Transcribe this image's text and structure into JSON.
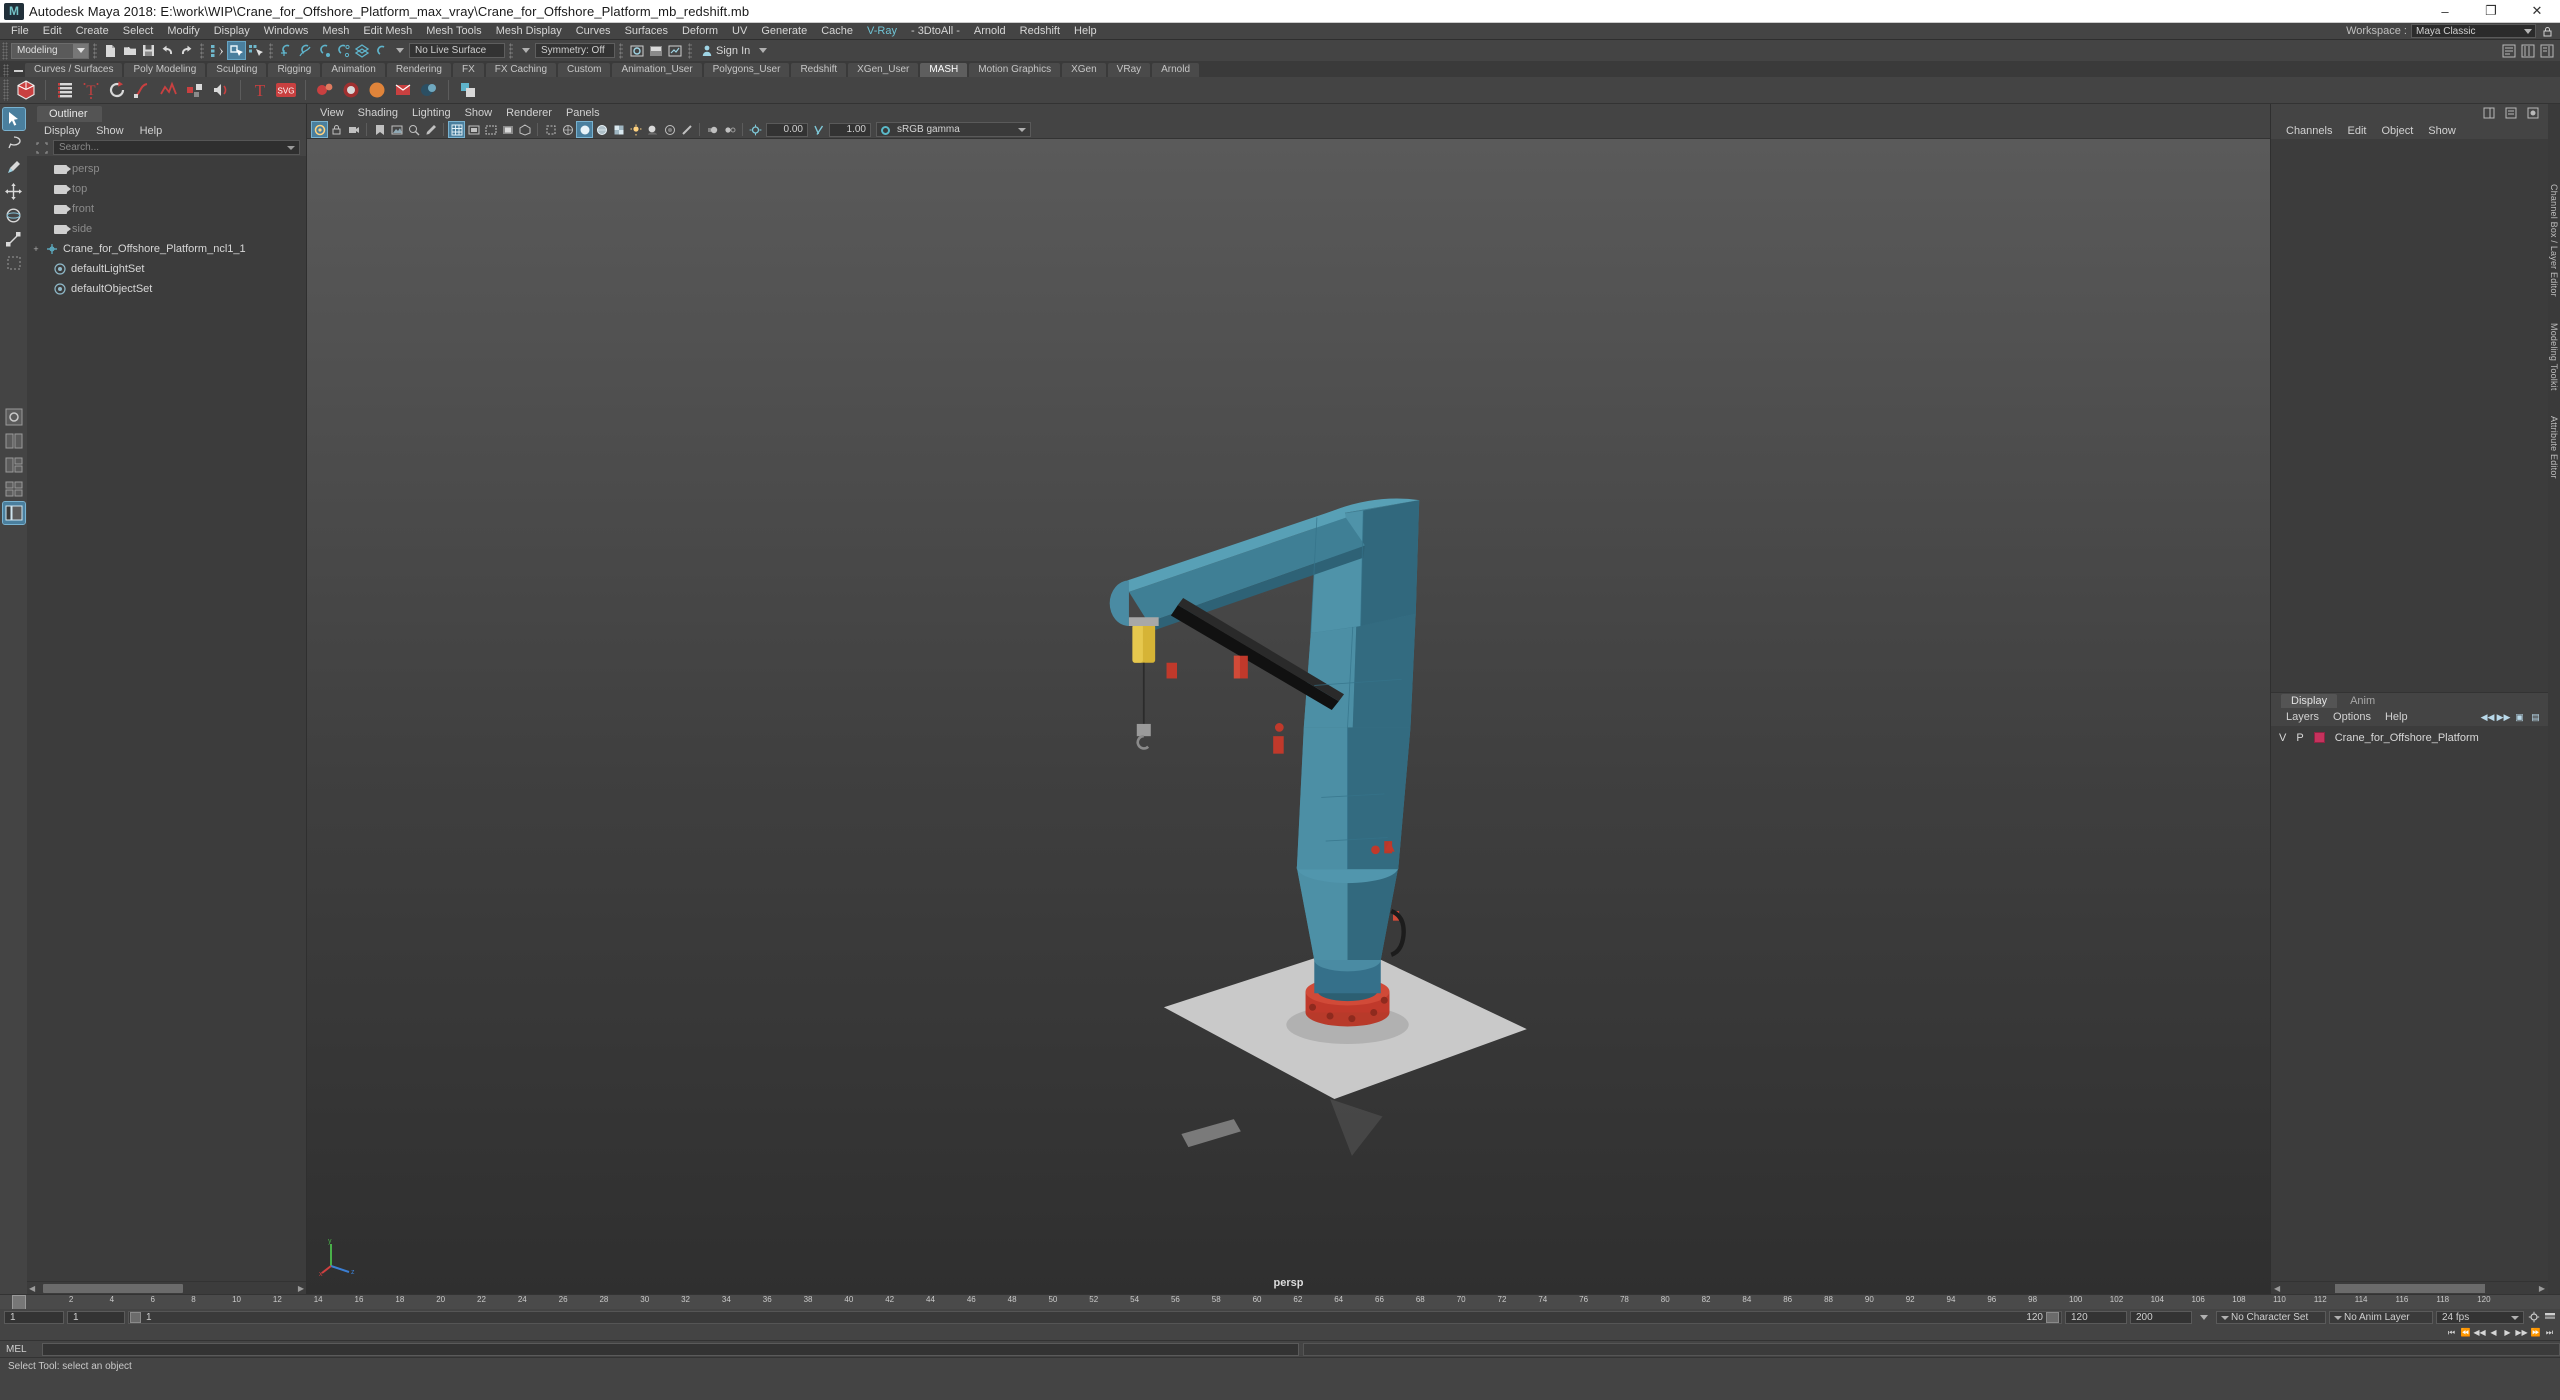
{
  "titlebar": {
    "app_icon": "maya-logo-icon",
    "title": "Autodesk Maya 2018: E:\\work\\WIP\\Crane_for_Offshore_Platform_max_vray\\Crane_for_Offshore_Platform_mb_redshift.mb",
    "minimize": "–",
    "maximize": "❐",
    "close": "✕"
  },
  "menubar": {
    "items": [
      {
        "label": "File"
      },
      {
        "label": "Edit"
      },
      {
        "label": "Create"
      },
      {
        "label": "Select"
      },
      {
        "label": "Modify"
      },
      {
        "label": "Display"
      },
      {
        "label": "Windows"
      },
      {
        "label": "Mesh"
      },
      {
        "label": "Edit Mesh"
      },
      {
        "label": "Mesh Tools"
      },
      {
        "label": "Mesh Display"
      },
      {
        "label": "Curves"
      },
      {
        "label": "Surfaces"
      },
      {
        "label": "Deform"
      },
      {
        "label": "UV"
      },
      {
        "label": "Generate"
      },
      {
        "label": "Cache"
      },
      {
        "label": "V-Ray",
        "accent": true
      },
      {
        "label": "- 3DtoAll -"
      },
      {
        "label": "Arnold"
      },
      {
        "label": "Redshift"
      },
      {
        "label": "Help"
      }
    ],
    "workspace_label": "Workspace :",
    "workspace_value": "Maya Classic"
  },
  "statusline": {
    "menu_set": "Modeling",
    "no_live_surface": "No Live Surface",
    "symmetry": "Symmetry: Off",
    "signin": "Sign In",
    "icons": [
      "new-scene-icon",
      "open-scene-icon",
      "save-scene-icon",
      "undo-icon",
      "redo-icon",
      "select-by-hierarchy-icon",
      "select-by-object-icon",
      "select-by-component-icon",
      "snap-to-grid-icon",
      "snap-to-curve-icon",
      "snap-to-point-icon",
      "snap-to-projected-center-icon",
      "snap-to-view-plane-icon",
      "snap-to-normal-icon"
    ]
  },
  "shelf": {
    "tabs": [
      {
        "label": "Curves / Surfaces"
      },
      {
        "label": "Poly Modeling"
      },
      {
        "label": "Sculpting"
      },
      {
        "label": "Rigging"
      },
      {
        "label": "Animation"
      },
      {
        "label": "Rendering"
      },
      {
        "label": "FX"
      },
      {
        "label": "FX Caching"
      },
      {
        "label": "Custom"
      },
      {
        "label": "Animation_User"
      },
      {
        "label": "Polygons_User"
      },
      {
        "label": "Redshift"
      },
      {
        "label": "XGen_User"
      },
      {
        "label": "MASH",
        "active": true
      },
      {
        "label": "Motion Graphics"
      },
      {
        "label": "XGen"
      },
      {
        "label": "VRay"
      },
      {
        "label": "Arnold"
      }
    ],
    "icon_names": [
      "mash-network-icon",
      "mash-distribute-icon",
      "mash-text-icon",
      "mash-trails-icon",
      "mash-curve-icon",
      "mash-signal-icon",
      "mash-random-icon",
      "mash-audio-icon",
      "mash-type-icon",
      "mash-svg-icon",
      "mash-dynamics-icon",
      "mash-color-icon",
      "mash-orange-icon",
      "mash-red-icon",
      "mash-blue-icon",
      "mash-replicator-icon"
    ]
  },
  "toolbox": {
    "tools": [
      {
        "name": "select-tool",
        "selected": true
      },
      {
        "name": "lasso-tool"
      },
      {
        "name": "paint-select-tool"
      },
      {
        "name": "move-tool"
      },
      {
        "name": "rotate-tool"
      },
      {
        "name": "scale-tool"
      },
      {
        "name": "last-tool-used"
      },
      {
        "name": "layout-single-icon"
      },
      {
        "name": "layout-two-panes-icon"
      },
      {
        "name": "layout-three-panes-icon"
      },
      {
        "name": "layout-four-panes-icon"
      },
      {
        "name": "layout-persp-outliner-icon"
      }
    ]
  },
  "outliner": {
    "tab": "Outliner",
    "menus": [
      "Display",
      "Show",
      "Help"
    ],
    "search_placeholder": "Search...",
    "items": [
      {
        "label": "persp",
        "icon": "camera-icon",
        "dim": true
      },
      {
        "label": "top",
        "icon": "camera-icon",
        "dim": true
      },
      {
        "label": "front",
        "icon": "camera-icon",
        "dim": true
      },
      {
        "label": "side",
        "icon": "camera-icon",
        "dim": true
      },
      {
        "label": "Crane_for_Offshore_Platform_ncl1_1",
        "icon": "transform-icon",
        "expandable": true
      },
      {
        "label": "defaultLightSet",
        "icon": "set-icon"
      },
      {
        "label": "defaultObjectSet",
        "icon": "set-icon"
      }
    ]
  },
  "viewport": {
    "menus": [
      "View",
      "Shading",
      "Lighting",
      "Show",
      "Renderer",
      "Panels"
    ],
    "exposure_value": "0.00",
    "gamma_value": "1.00",
    "color_management": "sRGB gamma",
    "camera_label": "persp",
    "axis": {
      "x": "x",
      "y": "y",
      "z": "z"
    },
    "model": {
      "name": "Crane for Offshore Platform",
      "body_color": "#3f7f95",
      "body_light": "#5794a8",
      "body_dark": "#2c5f72",
      "ground_color": "#c9c9c9",
      "accent_red": "#c0392b",
      "accent_yellow": "#d6b436"
    }
  },
  "channelbox": {
    "menus": [
      "Channels",
      "Edit",
      "Object",
      "Show"
    ]
  },
  "layers": {
    "tabs": [
      {
        "label": "Display",
        "active": true
      },
      {
        "label": "Anim",
        "active": false
      }
    ],
    "menus": [
      "Layers",
      "Options",
      "Help"
    ],
    "columns": [
      "V",
      "P"
    ],
    "rows": [
      {
        "v": "V",
        "p": "P",
        "color": "#c6325d",
        "name": "Crane_for_Offshore_Platform"
      }
    ]
  },
  "vertical_tabs": [
    "Channel Box / Layer Editor",
    "Modeling Toolkit",
    "Attribute Editor"
  ],
  "timeline": {
    "ticks": [
      "2",
      "4",
      "6",
      "8",
      "10",
      "12",
      "14",
      "16",
      "18",
      "20",
      "22",
      "24",
      "26",
      "28",
      "30",
      "32",
      "34",
      "36",
      "38",
      "40",
      "42",
      "44",
      "46",
      "48",
      "50",
      "52",
      "54",
      "56",
      "58",
      "60",
      "62",
      "64",
      "66",
      "68",
      "70",
      "72",
      "74",
      "76",
      "78",
      "80",
      "82",
      "84",
      "86",
      "88",
      "90",
      "92",
      "94",
      "96",
      "98",
      "100",
      "102",
      "104",
      "106",
      "108",
      "110",
      "112",
      "114",
      "116",
      "118",
      "120"
    ],
    "current_frame": "1",
    "range_start": "1",
    "range_end": "120",
    "anim_start": "1",
    "anim_end": "120",
    "playback_start": "120",
    "playback_end": "200",
    "character_set": "No Character Set",
    "anim_layer": "No Anim Layer",
    "fps": "24 fps"
  },
  "commandline": {
    "language": "MEL",
    "input_value": "",
    "output_value": ""
  },
  "helpline": {
    "message": "Select Tool: select an object"
  }
}
